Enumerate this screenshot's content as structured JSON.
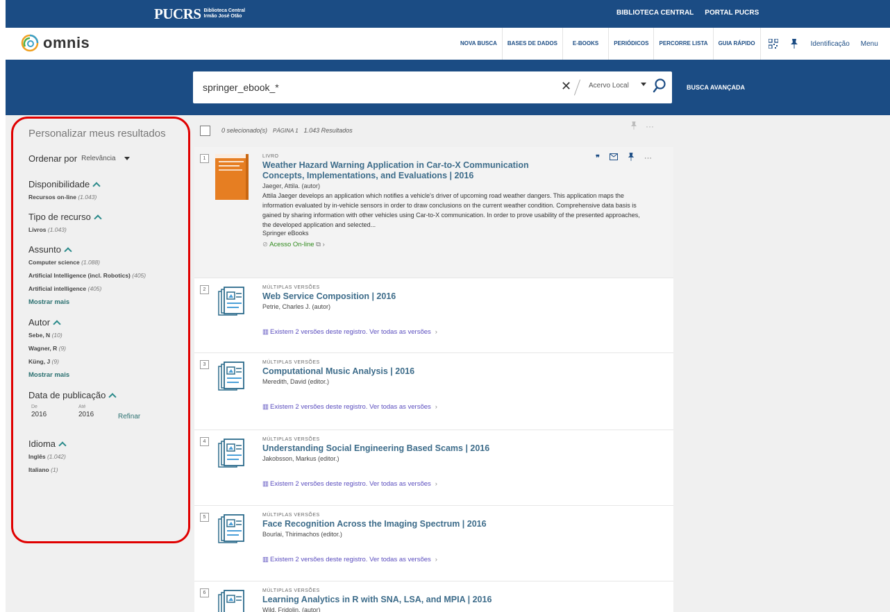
{
  "topbar": {
    "brand": "PUCRS",
    "brand_sub1": "Biblioteca Central",
    "brand_sub2": "Irmão José Otão",
    "links": [
      "BIBLIOTECA CENTRAL",
      "PORTAL PUCRS"
    ]
  },
  "header": {
    "logo_text": "omnis",
    "nav": [
      "NOVA BUSCA",
      "BASES DE DADOS",
      "E-BOOKS",
      "PERIÓDICOS",
      "PERCORRE LISTA",
      "GUIA RÁPIDO"
    ],
    "ident": "Identificação",
    "menu": "Menu"
  },
  "search": {
    "query": "springer_ebook_*",
    "scope": "Acervo Local",
    "advanced": "BUSCA AVANÇADA"
  },
  "sidebar": {
    "title": "Personalizar meus resultados",
    "sort_label": "Ordenar por",
    "sort_value": "Relevância",
    "groups": {
      "availability": {
        "title": "Disponibilidade",
        "items": [
          {
            "label": "Recursos on-line",
            "count": "(1.043)"
          }
        ]
      },
      "type": {
        "title": "Tipo de recurso",
        "items": [
          {
            "label": "Livros",
            "count": "(1.043)"
          }
        ]
      },
      "subject": {
        "title": "Assunto",
        "items": [
          {
            "label": "Computer science",
            "count": "(1.088)"
          },
          {
            "label": "Artificial Intelligence (incl. Robotics)",
            "count": "(405)"
          },
          {
            "label": "Artificial intelligence",
            "count": "(405)"
          }
        ],
        "more": "Mostrar mais"
      },
      "author": {
        "title": "Autor",
        "items": [
          {
            "label": "Sebe, N",
            "count": "(10)"
          },
          {
            "label": "Wagner, R",
            "count": "(9)"
          },
          {
            "label": "Küng, J",
            "count": "(9)"
          }
        ],
        "more": "Mostrar mais"
      },
      "date": {
        "title": "Data de publicação",
        "from_label": "De",
        "to_label": "Até",
        "from": "2016",
        "to": "2016",
        "refine": "Refinar"
      },
      "language": {
        "title": "Idioma",
        "items": [
          {
            "label": "Inglês",
            "count": "(1.042)"
          },
          {
            "label": "Italiano",
            "count": "(1)"
          }
        ]
      }
    }
  },
  "results_bar": {
    "selected": "0 selecionado(s)",
    "page": "PÁGINA 1",
    "count": "1.043 Resultados"
  },
  "records": [
    {
      "num": "1",
      "type": "LIVRO",
      "title": "Weather Hazard Warning Application in Car-to-X Communication Concepts, Implementations, and Evaluations | 2016",
      "author": "Jaeger, Attila. (autor)",
      "desc": "Attila Jaeger develops an application which notifies a vehicle's driver of upcoming road weather dangers. This application maps the information evaluated by in-vehicle sensors in order to draw conclusions on the current weather condition. Comprehensive data basis is gained by sharing information with other vehicles using Car-to-X communication. In order to prove usability of the presented approaches, the developed application and selected...",
      "source": "Springer eBooks",
      "access": "Acesso On-line"
    },
    {
      "num": "2",
      "type": "MÚLTIPLAS VERSÕES",
      "title": "Web Service Composition | 2016",
      "author": "Petrie, Charles J. (autor)",
      "versions": "Existem 2 versões deste registro. Ver todas as versões"
    },
    {
      "num": "3",
      "type": "MÚLTIPLAS VERSÕES",
      "title": "Computational Music Analysis | 2016",
      "author": "Meredith, David (editor.)",
      "versions": "Existem 2 versões deste registro. Ver todas as versões"
    },
    {
      "num": "4",
      "type": "MÚLTIPLAS VERSÕES",
      "title": "Understanding Social Engineering Based Scams | 2016",
      "author": "Jakobsson, Markus (editor.)",
      "versions": "Existem 2 versões deste registro. Ver todas as versões"
    },
    {
      "num": "5",
      "type": "MÚLTIPLAS VERSÕES",
      "title": "Face Recognition Across the Imaging Spectrum | 2016",
      "author": "Bourlai, Thirimachos (editor.)",
      "versions": "Existem 2 versões deste registro. Ver todas as versões"
    },
    {
      "num": "6",
      "type": "MÚLTIPLAS VERSÕES",
      "title": "Learning Analytics in R with SNA, LSA, and MPIA | 2016",
      "author": "Wild, Fridolin. (autor)"
    }
  ],
  "colors": {
    "primary": "#1b4c84",
    "accent": "#2a7070",
    "highlight": "#e00000",
    "access": "#2f8a1c",
    "versions": "#5a4dbe"
  },
  "icons": [
    "search-icon",
    "close-icon",
    "pin-icon",
    "qr-code-icon",
    "quote-icon",
    "email-icon",
    "more-icon",
    "link-icon",
    "external-link-icon",
    "versions-icon",
    "multiple-versions-icon"
  ]
}
